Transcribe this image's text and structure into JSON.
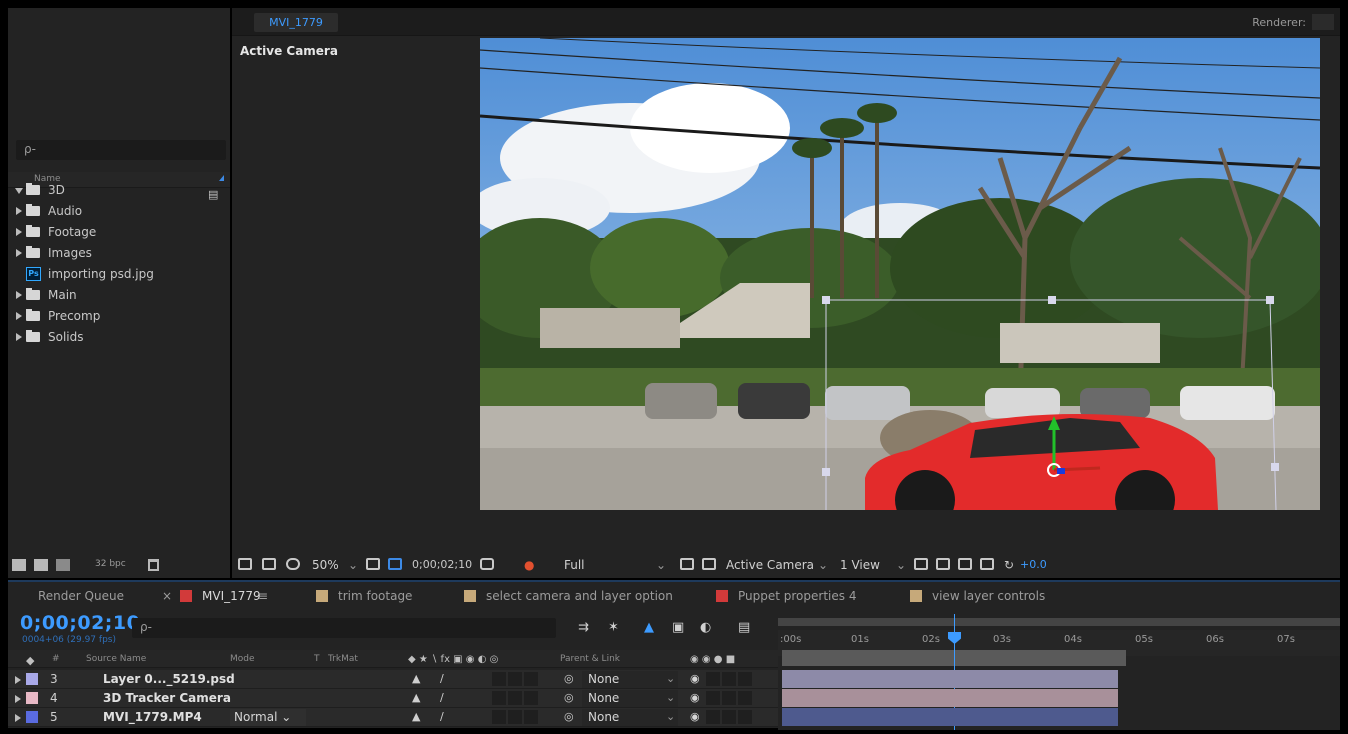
{
  "project": {
    "search_placeholder": "ρ-",
    "column_name": "Name",
    "items": [
      {
        "label": "3D",
        "type": "folder",
        "open": true
      },
      {
        "label": "Audio",
        "type": "folder"
      },
      {
        "label": "Footage",
        "type": "folder"
      },
      {
        "label": "Images",
        "type": "folder"
      },
      {
        "label": "importing psd.jpg",
        "type": "psd"
      },
      {
        "label": "Main",
        "type": "folder"
      },
      {
        "label": "Precomp",
        "type": "folder"
      },
      {
        "label": "Solids",
        "type": "folder"
      }
    ],
    "bpc": "32 bpc"
  },
  "composition": {
    "tab": "MVI_1779",
    "renderer_label": "Renderer:",
    "active_camera_label": "Active Camera",
    "footer": {
      "zoom": "50%",
      "timecode": "0;00;02;10",
      "resolution": "Full",
      "view": "Active Camera",
      "views_count": "1 View",
      "exposure": "+0.0"
    }
  },
  "timeline": {
    "tabs": [
      {
        "label": "Render Queue",
        "color": ""
      },
      {
        "label": "MVI_1779",
        "color": "#d23a3a",
        "active": true
      },
      {
        "label": "trim footage",
        "color": "#c6a97a"
      },
      {
        "label": "select camera and layer option",
        "color": "#c6a97a"
      },
      {
        "label": "Puppet properties 4",
        "color": "#d23a3a"
      },
      {
        "label": "view layer controls",
        "color": "#c6a97a"
      }
    ],
    "timecode": "0;00;02;10",
    "fps": "0004+06 (29.97 fps)",
    "search_placeholder": "ρ-",
    "columns": {
      "number": "#",
      "source_name": "Source Name",
      "mode": "Mode",
      "t": "T",
      "trkmat": "TrkMat",
      "parent": "Parent & Link"
    },
    "layers": [
      {
        "num": "3",
        "name": "Layer 0..._5219.psd",
        "color": "#a9a9e8",
        "mode": "",
        "parent": "None"
      },
      {
        "num": "4",
        "name": "3D Tracker Camera",
        "color": "#e8b9c6",
        "mode": "",
        "parent": "None"
      },
      {
        "num": "5",
        "name": "MVI_1779.MP4",
        "color": "#5a6be0",
        "mode": "Normal",
        "parent": "None"
      }
    ],
    "ruler_ticks": [
      ":00s",
      "01s",
      "02s",
      "03s",
      "04s",
      "05s",
      "06s",
      "07s"
    ]
  }
}
